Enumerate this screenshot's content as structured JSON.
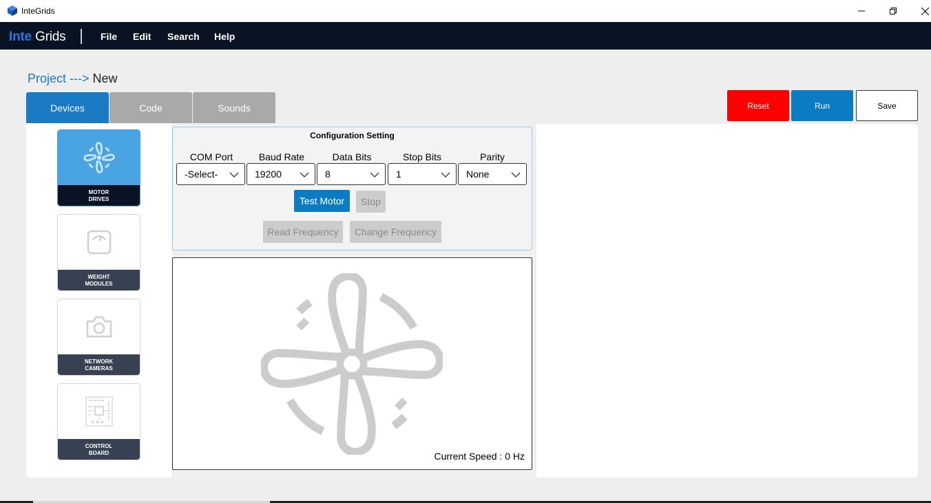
{
  "window": {
    "title": "InteGrids",
    "icons": {
      "app": "app-cube-icon",
      "minimize": "minimize-icon",
      "maximize": "restore-icon",
      "close": "close-icon"
    }
  },
  "menubar": {
    "brand_part1": "Inte",
    "brand_part2": "Grids",
    "items": [
      {
        "label": "File"
      },
      {
        "label": "Edit"
      },
      {
        "label": "Search"
      },
      {
        "label": "Help"
      }
    ]
  },
  "breadcrumb": {
    "link": "Project --->",
    "current": "New"
  },
  "tabs": [
    {
      "label": "Devices",
      "active": true
    },
    {
      "label": "Code",
      "active": false
    },
    {
      "label": "Sounds",
      "active": false
    }
  ],
  "actions": {
    "reset_label": "Reset",
    "run_label": "Run",
    "save_label": "Save"
  },
  "devices": [
    {
      "label": "MOTOR DRIVES",
      "icon": "fan-icon",
      "active": true
    },
    {
      "label": "WEIGHT MODULES",
      "icon": "scale-icon",
      "active": false
    },
    {
      "label": "NETWORK CAMERAS",
      "icon": "camera-icon",
      "active": false
    },
    {
      "label": "CONTROL BOARD",
      "icon": "circuit-board-icon",
      "active": false
    }
  ],
  "config": {
    "title": "Configuration Setting",
    "fields": [
      {
        "label": "COM Port",
        "value": "-Select-"
      },
      {
        "label": "Baud Rate",
        "value": "19200"
      },
      {
        "label": "Data Bits",
        "value": "8"
      },
      {
        "label": "Stop Bits",
        "value": "1"
      },
      {
        "label": "Parity",
        "value": "None"
      }
    ],
    "test_motor_label": "Test Motor",
    "stop_label": "Stop",
    "read_frequency_label": "Read Frequency",
    "change_frequency_label": "Change Frequency"
  },
  "motor": {
    "icon": "fan-icon",
    "speed_label": "Current Speed :",
    "speed_value": "0 Hz"
  },
  "colors": {
    "accent": "#1a7ac4",
    "menubar": "#0a1324",
    "reset": "#ff0000",
    "active_card": "#4aa3e3",
    "disabled": "#cccccc"
  }
}
